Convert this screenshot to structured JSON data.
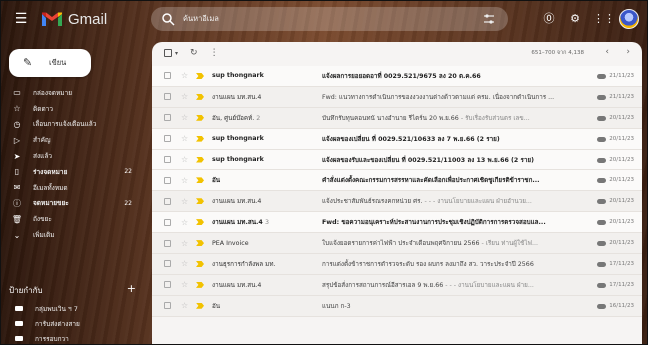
{
  "app": {
    "name": "Gmail",
    "brand_colors": {
      "red": "#ea4335",
      "blue": "#4285f4",
      "green": "#34a853",
      "yellow": "#fbbc04"
    }
  },
  "search": {
    "text": "ค้นหาอีเมล"
  },
  "compose": {
    "label": "เขียน"
  },
  "sidebar": {
    "items": [
      {
        "icon": "inbox-icon",
        "label": "กล่องจดหมาย",
        "count": "",
        "bold": false
      },
      {
        "icon": "star-icon",
        "label": "ติดดาว",
        "count": "",
        "bold": false
      },
      {
        "icon": "clock-icon",
        "label": "เลื่อนการแจ้งเตือนแล้ว",
        "count": "",
        "bold": false
      },
      {
        "icon": "important-icon",
        "label": "สำคัญ",
        "count": "",
        "bold": false
      },
      {
        "icon": "send-icon",
        "label": "ส่งแล้ว",
        "count": "",
        "bold": false
      },
      {
        "icon": "draft-icon",
        "label": "ร่างจดหมาย",
        "count": "22",
        "bold": true
      },
      {
        "icon": "mail-icon",
        "label": "อีเมลทั้งหมด",
        "count": "",
        "bold": false
      },
      {
        "icon": "spam-icon",
        "label": "จดหมายขยะ",
        "count": "22",
        "bold": true
      },
      {
        "icon": "trash-icon",
        "label": "ถังขยะ",
        "count": "",
        "bold": false
      },
      {
        "icon": "chevron-down-icon",
        "label": "เพิ่มเติม",
        "count": "",
        "bold": false
      }
    ],
    "labels_title": "ป้ายกำกับ",
    "labels": [
      "กลุ่มพบเวิน ฯ 7",
      "การับส่งต่างสาย",
      "การรอบกวา"
    ]
  },
  "toolbar": {
    "pager": "651–700 จาก 4,138"
  },
  "emails": [
    {
      "sender": "sup thongnark",
      "count": "",
      "subject": "แจ้งผลการยอยอดอาที่ 0029.521/9675 ลง 20 ต.ค.66",
      "snippet": "",
      "date": "21/11/23",
      "unread": true,
      "attach": true
    },
    {
      "sender": "งานแผน มท.สน.4",
      "count": "",
      "subject": "Fwd: แนวทางการดำเนินการของงวงงานต่างด้าวตามแต่ ครม. เนื่องจากดำเนินการ ...",
      "snippet": "",
      "date": "21/11/23",
      "unread": false,
      "attach": true
    },
    {
      "sender": "อัน, ศูนย์บ๊อคท์.",
      "count": "2",
      "subject": "บันทึกรับทุนคอนทนั นางอำนาย รีไตร์น 20 พ.ย.66",
      "snippet": " - รับเรื่องรับส่วนตร เลข...",
      "date": "20/11/23",
      "unread": false,
      "attach": true
    },
    {
      "sender": "sup thongnark",
      "count": "",
      "subject": "แจ้งผลของเปลี่ยน ที่ 0029.521/10633 ลง 7 พ.ย.66 (2 ราย)",
      "snippet": "",
      "date": "20/11/23",
      "unread": true,
      "attach": true
    },
    {
      "sender": "sup thongnark",
      "count": "",
      "subject": "แจ้งผลของรับและของเปลี่ยน ที่ 0029.521/11003 ลง 13 พ.ย.66 (2 ราย)",
      "snippet": "",
      "date": "20/11/23",
      "unread": true,
      "attach": true
    },
    {
      "sender": "อัน",
      "count": "",
      "subject": "คำสั่งแต่งตั้งคณะกรรมการสรรหาและคัดเลือกเพื่อประกาศเชิดชูเกียรติข้าราชก...",
      "snippet": "",
      "date": "20/11/23",
      "unread": true,
      "attach": true
    },
    {
      "sender": "งานแผน มท.สน.4",
      "count": "",
      "subject": "แจ้งประชาสัมพันธ์รณรงคกหน่วย ศร.",
      "snippet": " - - - งานนโยบายและแผน ฝ่ายอำนวย...",
      "date": "20/11/23",
      "unread": false,
      "attach": true
    },
    {
      "sender": "งานแผน มท.สน.4",
      "count": "3",
      "subject": "Fwd: ขอความอนุเคราะห์ประสานงานการประชุมเชิงปฏิบัติการการตรวจสอบแล...",
      "snippet": "",
      "date": "20/11/23",
      "unread": true,
      "attach": true
    },
    {
      "sender": "PEA Invoice",
      "count": "",
      "subject": "ใบแจ้งยอดรายการค่าไฟฟ้า ประจำเดือนพฤศจิกายน 2566",
      "snippet": " - เรียน ท่านผู้ใช้ไฟ...",
      "date": "20/11/23",
      "unread": false,
      "attach": true
    },
    {
      "sender": "งานธุรการกำลังพล มท.",
      "count": "",
      "subject": "การแต่งตั้งข้าราชการตำรวจระดับ รอง ผบกร ลงมาถึง สว. วาระประจำปี 2566",
      "snippet": "",
      "date": "17/11/23",
      "unread": false,
      "attach": true
    },
    {
      "sender": "งานแผน มท.สน.4",
      "count": "",
      "subject": "สรุปข้อสั่งการสถานการณ์อีสารเอล 9 พ.ย.66",
      "snippet": " - - - งานนโยบายและแผน ฝ่าย...",
      "date": "17/11/23",
      "unread": false,
      "attach": true
    },
    {
      "sender": "อัน",
      "count": "",
      "subject": "แนบภ ก-3",
      "snippet": "",
      "date": "16/11/23",
      "unread": false,
      "attach": true
    }
  ]
}
